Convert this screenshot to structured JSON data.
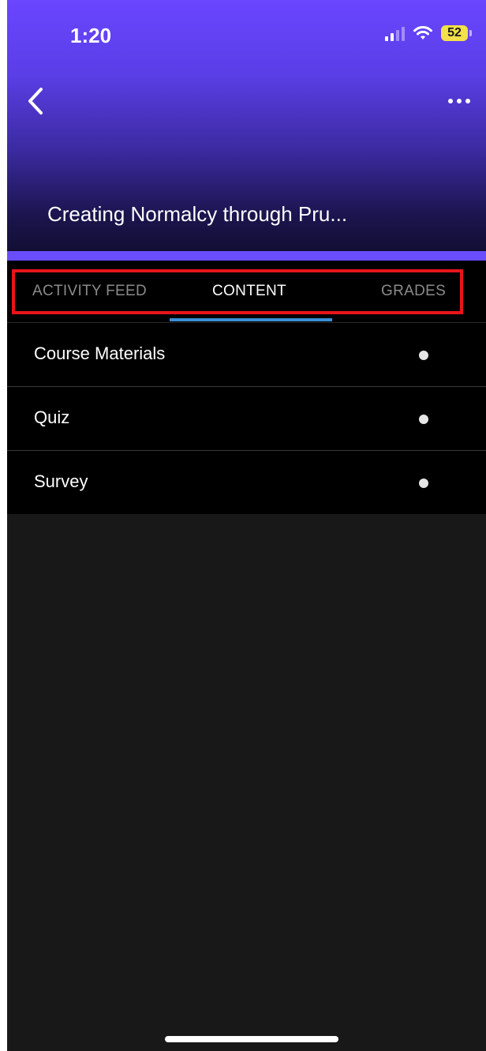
{
  "status_bar": {
    "time": "1:20",
    "battery": "52",
    "icons": [
      "signal-icon",
      "wifi-icon",
      "battery-icon"
    ]
  },
  "header": {
    "back_icon": "chevron-left-icon",
    "more_icon": "ellipsis-icon",
    "course_title": "Creating Normalcy through Pru..."
  },
  "tabs": [
    {
      "label": "ACTIVITY FEED",
      "selected": false
    },
    {
      "label": "CONTENT",
      "selected": true
    },
    {
      "label": "GRADES",
      "selected": false
    }
  ],
  "content_items": [
    {
      "label": "Course Materials",
      "icon": "dot-icon"
    },
    {
      "label": "Quiz",
      "icon": "dot-icon"
    },
    {
      "label": "Survey",
      "icon": "dot-icon"
    }
  ],
  "colors": {
    "header_top": "#6a46ff",
    "accent_bar": "#6a4dff",
    "tab_indicator": "#3a8fd6",
    "highlight_box": "#e8141a",
    "background": "#181818"
  }
}
